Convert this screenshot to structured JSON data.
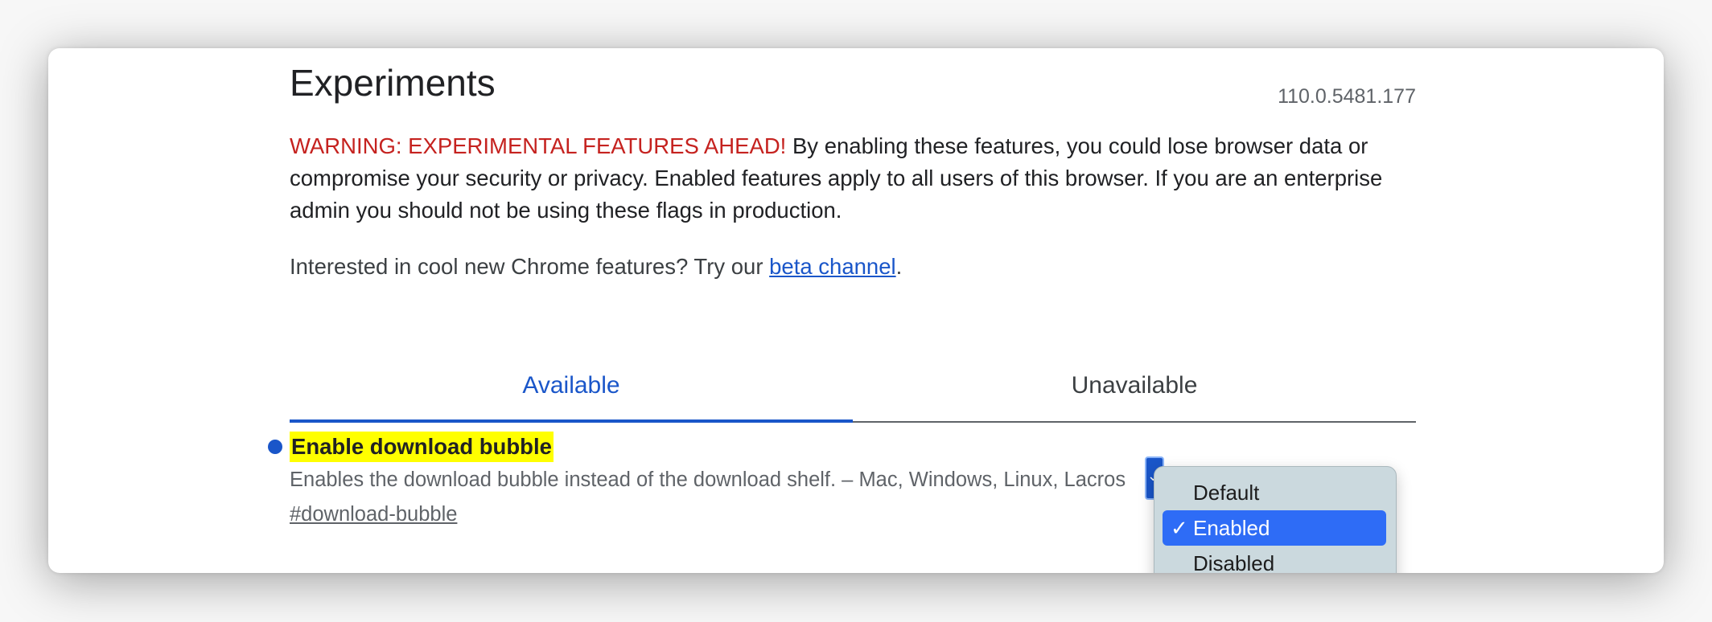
{
  "page": {
    "title": "Experiments",
    "version": "110.0.5481.177"
  },
  "warning": {
    "label": "WARNING: EXPERIMENTAL FEATURES AHEAD!",
    "text": " By enabling these features, you could lose browser data or compromise your security or privacy. Enabled features apply to all users of this browser. If you are an enterprise admin you should not be using these flags in production."
  },
  "interest": {
    "text_before": "Interested in cool new Chrome features? Try our ",
    "link": "beta channel",
    "text_after": "."
  },
  "tabs": [
    {
      "label": "Available",
      "active": true
    },
    {
      "label": "Unavailable",
      "active": false
    }
  ],
  "flag": {
    "name": "Enable download bubble",
    "description": "Enables the download bubble instead of the download shelf. – Mac, Windows, Linux, Lacros",
    "link": "#download-bubble"
  },
  "dropdown": {
    "options": [
      "Default",
      "Enabled",
      "Disabled"
    ],
    "selected": "Enabled",
    "check_glyph": "✓"
  },
  "colors": {
    "accent": "#1a56c9",
    "warning": "#c5221f",
    "highlight": "#ffff00",
    "selected_option": "#2e6cf6"
  }
}
